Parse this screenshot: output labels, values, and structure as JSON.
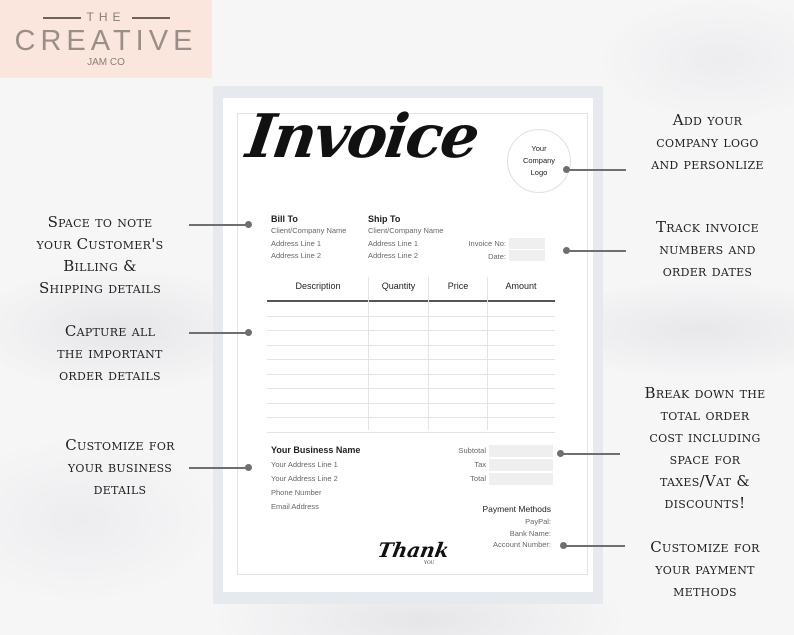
{
  "brand": {
    "line1": "THE",
    "line2": "CREATIVE",
    "line3": "JAM CO"
  },
  "invoice": {
    "title": "Invoice",
    "logo_placeholder": [
      "Your",
      "Company",
      "Logo"
    ],
    "bill_to": {
      "heading": "Bill To",
      "lines": [
        "Client/Company Name",
        "Address Line 1",
        "Address Line 2"
      ]
    },
    "ship_to": {
      "heading": "Ship To",
      "lines": [
        "Client/Company Name",
        "Address Line 1",
        "Address Line 2"
      ]
    },
    "meta_labels": [
      "Invoice No:",
      "Date:"
    ],
    "table": {
      "columns": [
        "Description",
        "Quantity",
        "Price",
        "Amount"
      ],
      "rows": 9
    },
    "business": {
      "heading": "Your Business Name",
      "lines": [
        "Your Address Line 1",
        "Your Address Line 2",
        "Phone Number",
        "Email Address"
      ]
    },
    "totals_labels": [
      "Subtotal",
      "Tax",
      "Total"
    ],
    "payment": {
      "heading": "Payment Methods",
      "lines": [
        "PayPal:",
        "Bank Name:",
        "Account Number:"
      ]
    },
    "thanks": "Thank",
    "thanks_sub": "YOU"
  },
  "callouts": {
    "logo": [
      "Add your",
      "company logo",
      "and personlize"
    ],
    "billing": [
      "Space to note",
      "your Customer's",
      "Billing &",
      "Shipping details"
    ],
    "invoice_numbers": [
      "Track invoice",
      "numbers and",
      "order dates"
    ],
    "order": [
      "Capture all",
      "the important",
      "order details"
    ],
    "totals": [
      "Break down the",
      "total order",
      "cost including",
      "space for",
      "taxes/Vat &",
      "discounts!"
    ],
    "business": [
      "Customize for",
      "your business",
      "details"
    ],
    "payment": [
      "Customize for",
      "your payment",
      "methods"
    ]
  },
  "colors": {
    "frame": "#e6e9ed",
    "brand_bg": "#fbe6dd",
    "connector": "#6f6f6f"
  }
}
